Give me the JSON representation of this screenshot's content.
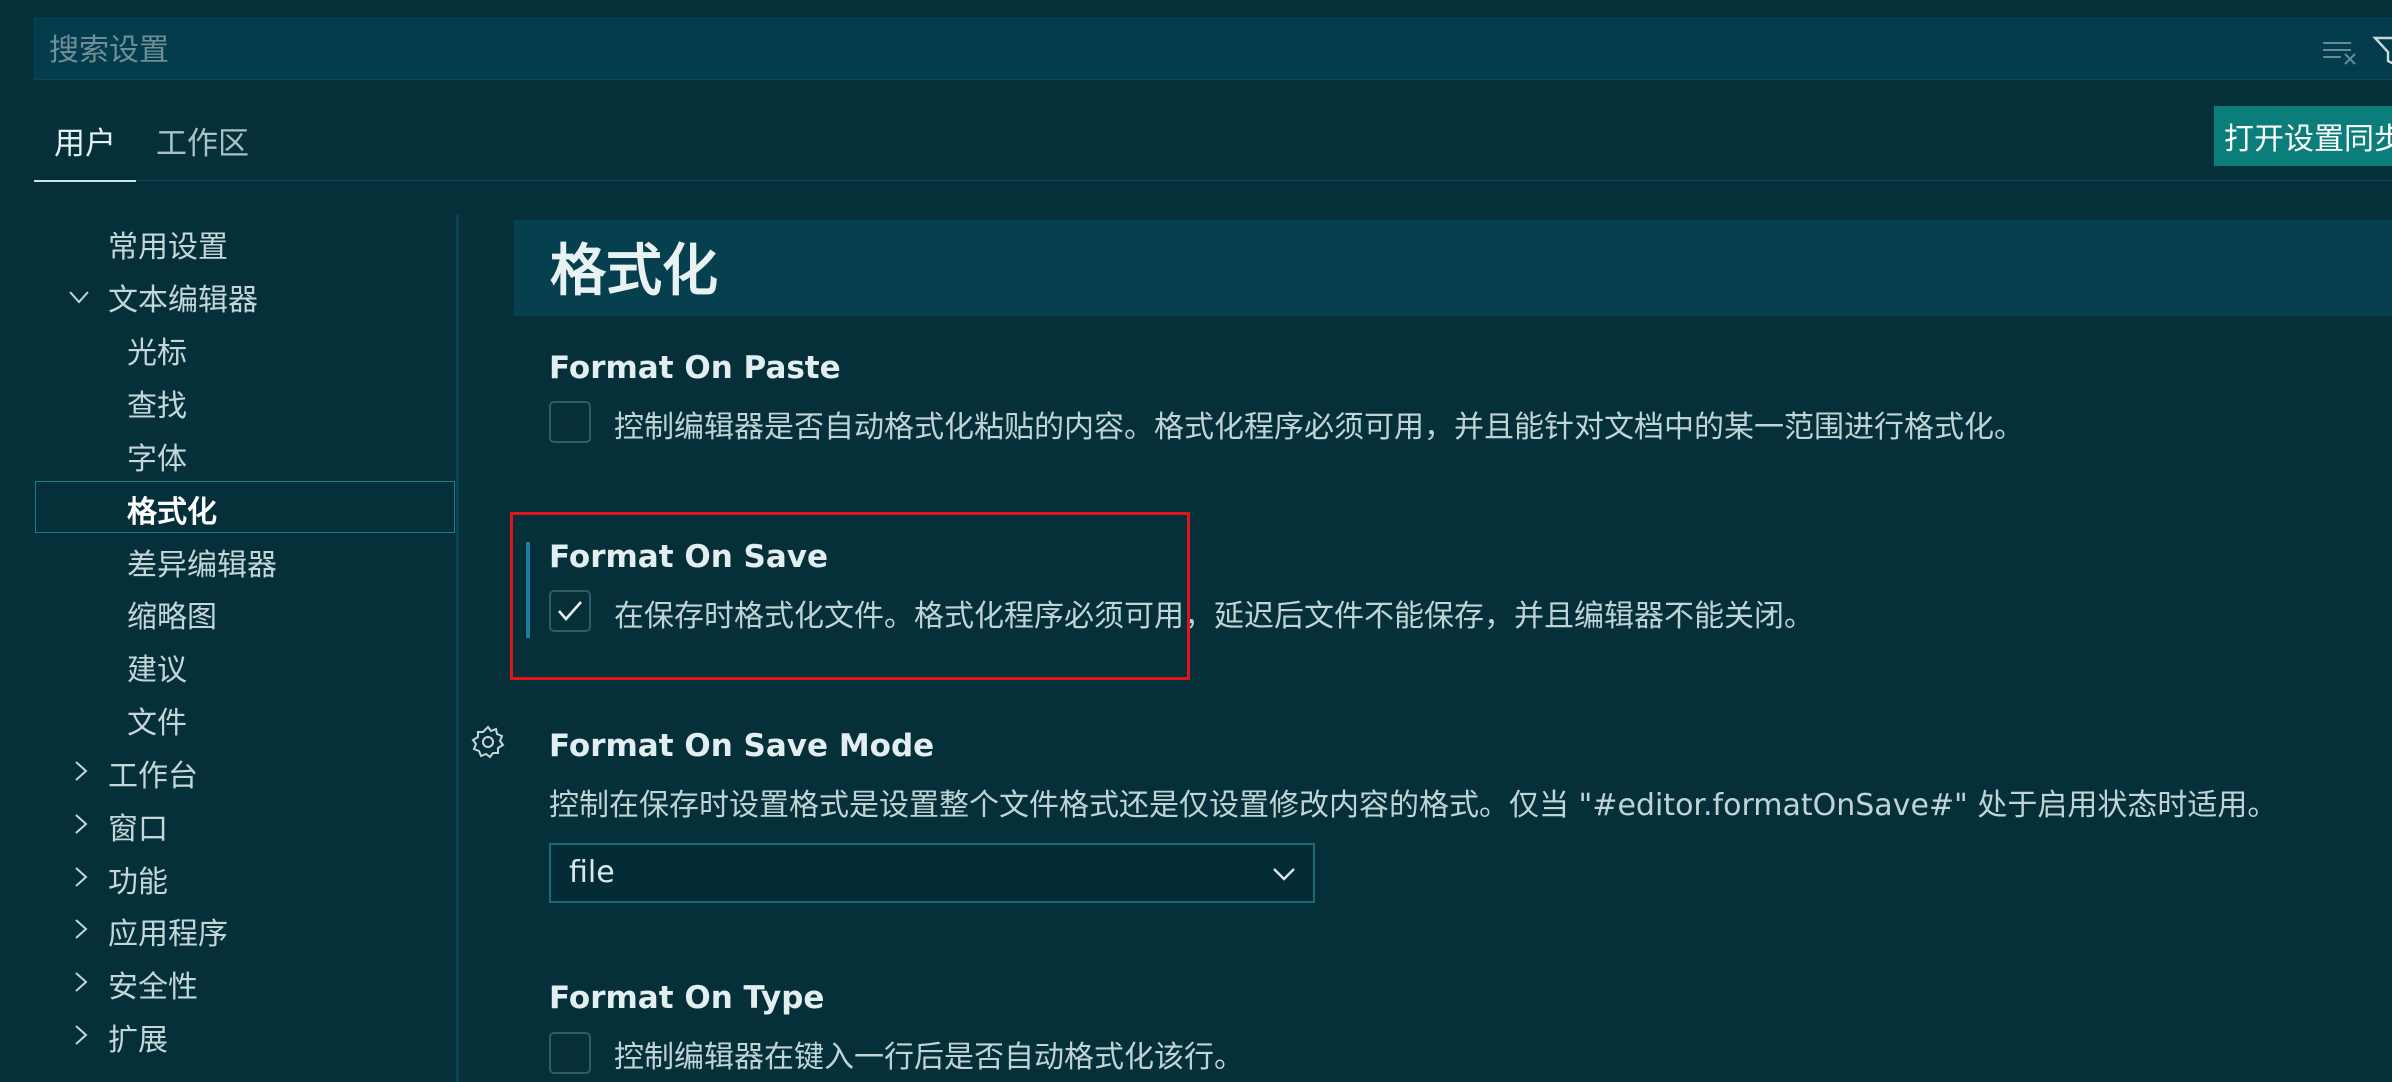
{
  "search": {
    "placeholder": "搜索设置"
  },
  "tabs": [
    {
      "label": "用户",
      "active": true
    },
    {
      "label": "工作区",
      "active": false
    }
  ],
  "sync_button": {
    "label": "打开设置同步"
  },
  "sidebar": {
    "items": [
      {
        "label": "常用设置"
      },
      {
        "label": "文本编辑器",
        "expanded": true
      },
      {
        "label": "光标"
      },
      {
        "label": "查找"
      },
      {
        "label": "字体"
      },
      {
        "label": "格式化",
        "selected": true
      },
      {
        "label": "差异编辑器"
      },
      {
        "label": "缩略图"
      },
      {
        "label": "建议"
      },
      {
        "label": "文件"
      },
      {
        "label": "工作台",
        "expanded": false
      },
      {
        "label": "窗口",
        "expanded": false
      },
      {
        "label": "功能",
        "expanded": false
      },
      {
        "label": "应用程序",
        "expanded": false
      },
      {
        "label": "安全性",
        "expanded": false
      },
      {
        "label": "扩展",
        "expanded": false
      }
    ]
  },
  "section": {
    "title": "格式化"
  },
  "settings": [
    {
      "title": "Format On Paste",
      "description": "控制编辑器是否自动格式化粘贴的内容。格式化程序必须可用，并且能针对文档中的某一范围进行格式化。",
      "checked": false
    },
    {
      "title": "Format On Save",
      "description": "在保存时格式化文件。格式化程序必须可用，延迟后文件不能保存，并且编辑器不能关闭。",
      "checked": true
    },
    {
      "title": "Format On Save Mode",
      "description": "控制在保存时设置格式是设置整个文件格式还是仅设置修改内容的格式。仅当 \"#editor.formatOnSave#\" 处于启用状态时适用。",
      "value": "file"
    },
    {
      "title": "Format On Type",
      "description": "控制编辑器在键入一行后是否自动格式化该行。",
      "checked": false
    }
  ],
  "colors": {
    "background": "#05303a",
    "accent": "#0b7d7a",
    "highlight": "#e0151b"
  }
}
